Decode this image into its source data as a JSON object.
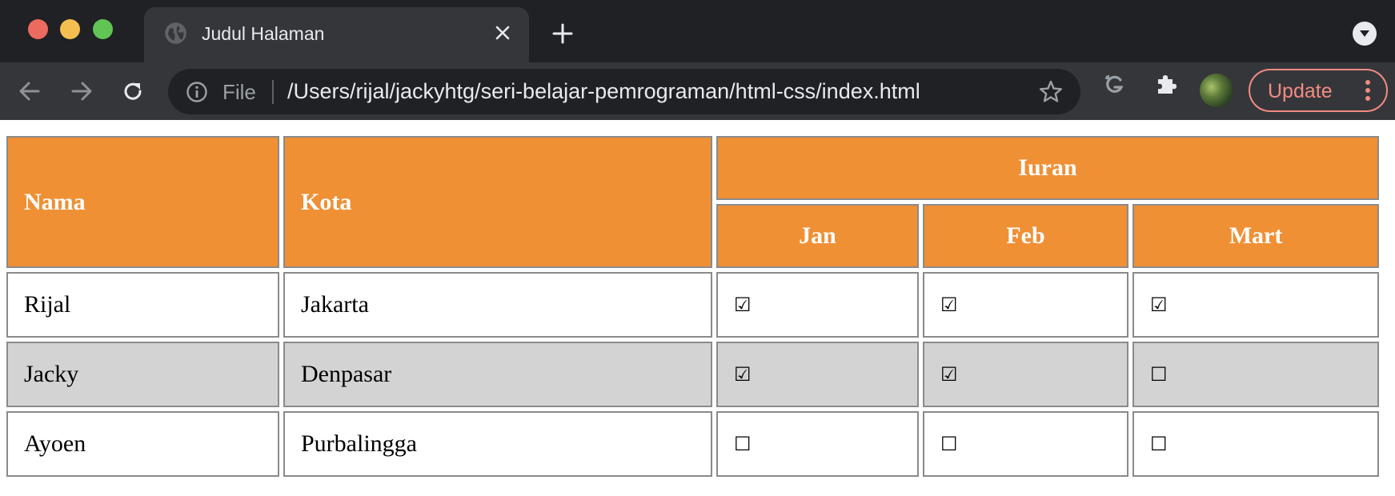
{
  "browser": {
    "tab_title": "Judul Halaman",
    "omnibox_scheme": "File",
    "omnibox_url": "/Users/rijal/jackyhtg/seri-belajar-pemrograman/html-css/index.html",
    "update_label": "Update",
    "accent_update": "#f28b82",
    "icons": [
      "globe-icon",
      "close-icon",
      "plus-icon",
      "tab-search-icon",
      "back-arrow-icon",
      "forward-arrow-icon",
      "reload-icon",
      "info-icon",
      "star-icon",
      "grammarly-extension-icon",
      "puzzle-extensions-icon",
      "profile-avatar",
      "more-vert-icon"
    ]
  },
  "table": {
    "header": {
      "nama": "Nama",
      "kota": "Kota",
      "iuran": "Iuran",
      "months": [
        "Jan",
        "Feb",
        "Mart"
      ]
    },
    "header_color": "#ef9035",
    "alt_row_color": "#d3d3d3",
    "rows": [
      {
        "nama": "Rijal",
        "kota": "Jakarta",
        "checks": [
          "☑",
          "☑",
          "☑"
        ]
      },
      {
        "nama": "Jacky",
        "kota": "Denpasar",
        "checks": [
          "☑",
          "☑",
          "☐"
        ]
      },
      {
        "nama": "Ayoen",
        "kota": "Purbalingga",
        "checks": [
          "☐",
          "☐",
          "☐"
        ]
      }
    ]
  }
}
